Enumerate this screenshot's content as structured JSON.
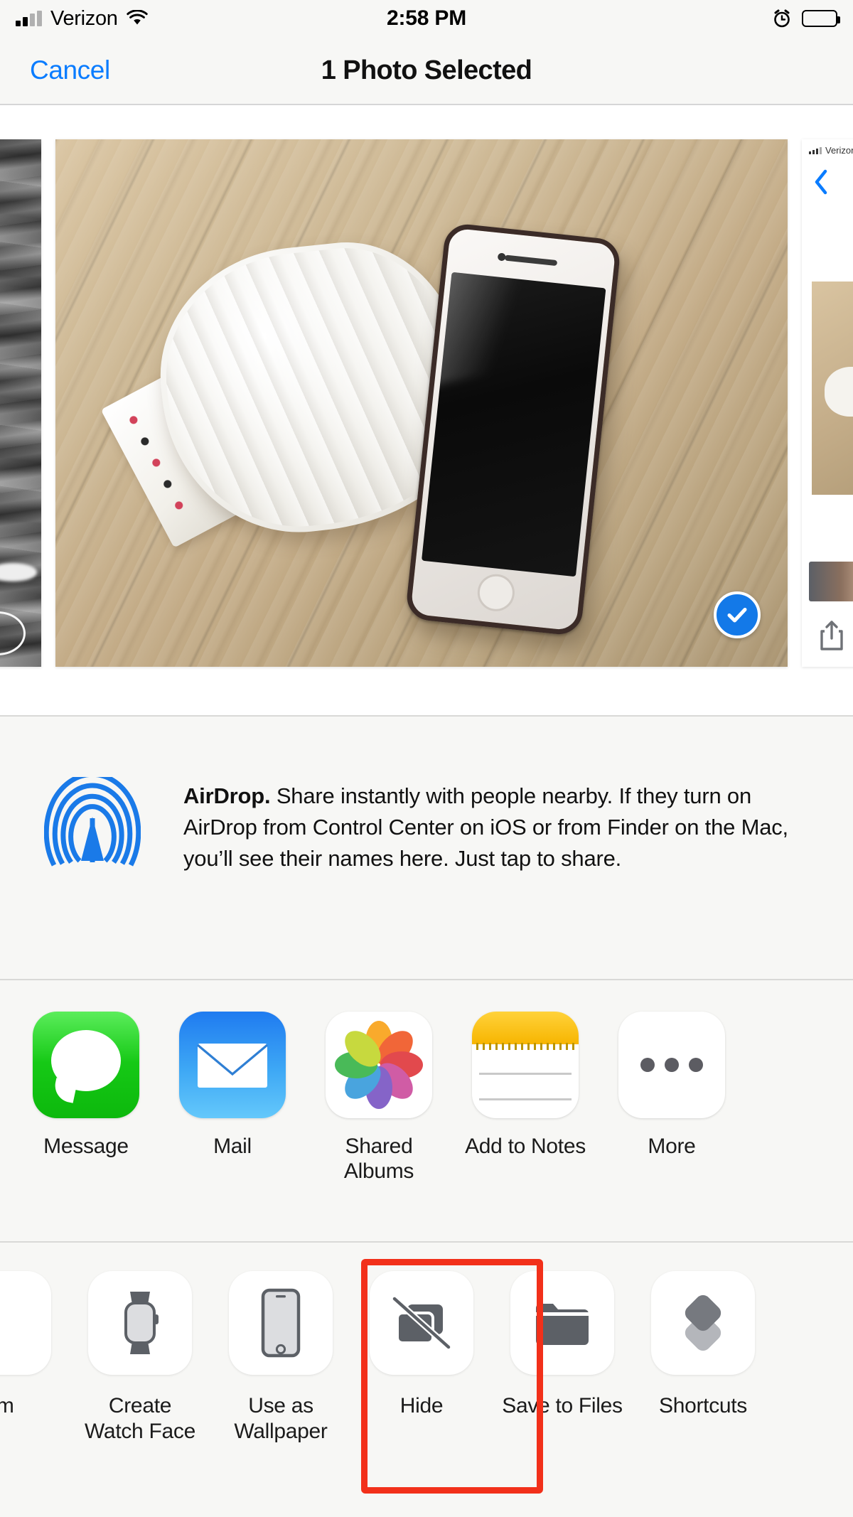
{
  "status_bar": {
    "carrier": "Verizon",
    "time": "2:58 PM",
    "signal_icon": "cellular-bars-icon",
    "wifi_icon": "wifi-icon",
    "alarm_icon": "alarm-clock-icon",
    "battery_icon": "battery-icon"
  },
  "nav": {
    "cancel_label": "Cancel",
    "title": "1 Photo Selected"
  },
  "photo_strip": {
    "left_thumb_name": "previous-photo-thumbnail",
    "selected_photo_name": "selected-photo",
    "selected_photo_description": "Wooden floor with folded white towel and an iPhone",
    "right_thumb_name": "next-photo-thumbnail",
    "selected_badge_icon": "checkmark-circle-icon",
    "selected_badge_color": "#1379e8"
  },
  "airdrop": {
    "icon": "airdrop-icon",
    "icon_color": "#1a7ae8",
    "bold_label": "AirDrop.",
    "body": " Share instantly with people nearby. If they turn on AirDrop from Control Center on iOS or from Finder on the Mac, you’ll see their names here. Just tap to share."
  },
  "app_row": {
    "items": [
      {
        "label": "Message",
        "icon": "messages-app-icon",
        "color": "#16c916"
      },
      {
        "label": "Mail",
        "icon": "mail-app-icon",
        "color": "#3ea8f5"
      },
      {
        "label": "Shared Albums",
        "icon": "photos-app-icon",
        "color": "#ffffff"
      },
      {
        "label": "Add to Notes",
        "icon": "notes-app-icon",
        "color": "#f7b500"
      },
      {
        "label": "More",
        "icon": "ellipsis-icon",
        "color": "#5c5c62"
      }
    ]
  },
  "action_row": {
    "items": [
      {
        "label": "um",
        "icon": "album-icon"
      },
      {
        "label": "Create Watch Face",
        "icon": "apple-watch-icon"
      },
      {
        "label": "Use as Wallpaper",
        "icon": "iphone-icon"
      },
      {
        "label": "Hide",
        "icon": "hide-photo-slash-icon"
      },
      {
        "label": "Save to Files",
        "icon": "folder-icon"
      },
      {
        "label": "Shortcuts",
        "icon": "shortcuts-icon"
      }
    ],
    "highlighted_item": "Hide",
    "highlight_color": "#f2301a"
  }
}
